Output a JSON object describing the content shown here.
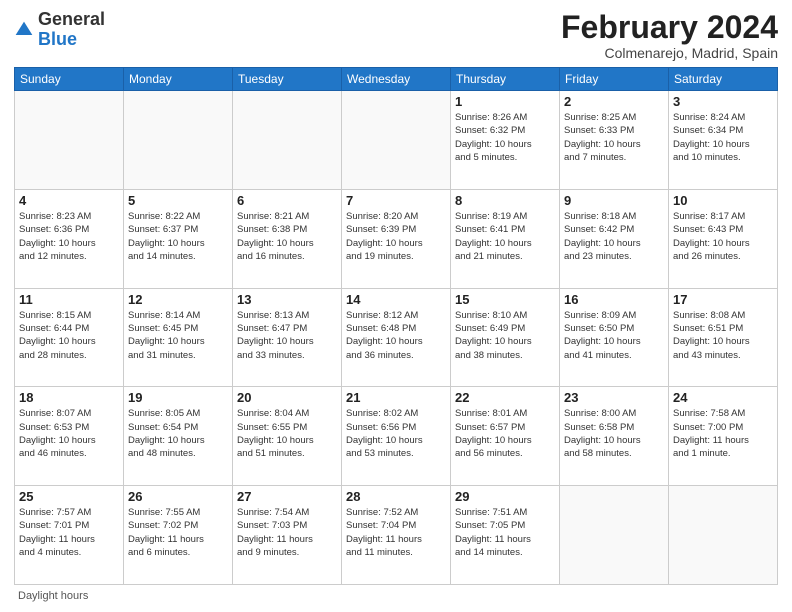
{
  "logo": {
    "general": "General",
    "blue": "Blue"
  },
  "header": {
    "month": "February 2024",
    "location": "Colmenarejo, Madrid, Spain"
  },
  "days_of_week": [
    "Sunday",
    "Monday",
    "Tuesday",
    "Wednesday",
    "Thursday",
    "Friday",
    "Saturday"
  ],
  "footer": {
    "label": "Daylight hours"
  },
  "weeks": [
    [
      {
        "day": "",
        "content": ""
      },
      {
        "day": "",
        "content": ""
      },
      {
        "day": "",
        "content": ""
      },
      {
        "day": "",
        "content": ""
      },
      {
        "day": "1",
        "content": "Sunrise: 8:26 AM\nSunset: 6:32 PM\nDaylight: 10 hours\nand 5 minutes."
      },
      {
        "day": "2",
        "content": "Sunrise: 8:25 AM\nSunset: 6:33 PM\nDaylight: 10 hours\nand 7 minutes."
      },
      {
        "day": "3",
        "content": "Sunrise: 8:24 AM\nSunset: 6:34 PM\nDaylight: 10 hours\nand 10 minutes."
      }
    ],
    [
      {
        "day": "4",
        "content": "Sunrise: 8:23 AM\nSunset: 6:36 PM\nDaylight: 10 hours\nand 12 minutes."
      },
      {
        "day": "5",
        "content": "Sunrise: 8:22 AM\nSunset: 6:37 PM\nDaylight: 10 hours\nand 14 minutes."
      },
      {
        "day": "6",
        "content": "Sunrise: 8:21 AM\nSunset: 6:38 PM\nDaylight: 10 hours\nand 16 minutes."
      },
      {
        "day": "7",
        "content": "Sunrise: 8:20 AM\nSunset: 6:39 PM\nDaylight: 10 hours\nand 19 minutes."
      },
      {
        "day": "8",
        "content": "Sunrise: 8:19 AM\nSunset: 6:41 PM\nDaylight: 10 hours\nand 21 minutes."
      },
      {
        "day": "9",
        "content": "Sunrise: 8:18 AM\nSunset: 6:42 PM\nDaylight: 10 hours\nand 23 minutes."
      },
      {
        "day": "10",
        "content": "Sunrise: 8:17 AM\nSunset: 6:43 PM\nDaylight: 10 hours\nand 26 minutes."
      }
    ],
    [
      {
        "day": "11",
        "content": "Sunrise: 8:15 AM\nSunset: 6:44 PM\nDaylight: 10 hours\nand 28 minutes."
      },
      {
        "day": "12",
        "content": "Sunrise: 8:14 AM\nSunset: 6:45 PM\nDaylight: 10 hours\nand 31 minutes."
      },
      {
        "day": "13",
        "content": "Sunrise: 8:13 AM\nSunset: 6:47 PM\nDaylight: 10 hours\nand 33 minutes."
      },
      {
        "day": "14",
        "content": "Sunrise: 8:12 AM\nSunset: 6:48 PM\nDaylight: 10 hours\nand 36 minutes."
      },
      {
        "day": "15",
        "content": "Sunrise: 8:10 AM\nSunset: 6:49 PM\nDaylight: 10 hours\nand 38 minutes."
      },
      {
        "day": "16",
        "content": "Sunrise: 8:09 AM\nSunset: 6:50 PM\nDaylight: 10 hours\nand 41 minutes."
      },
      {
        "day": "17",
        "content": "Sunrise: 8:08 AM\nSunset: 6:51 PM\nDaylight: 10 hours\nand 43 minutes."
      }
    ],
    [
      {
        "day": "18",
        "content": "Sunrise: 8:07 AM\nSunset: 6:53 PM\nDaylight: 10 hours\nand 46 minutes."
      },
      {
        "day": "19",
        "content": "Sunrise: 8:05 AM\nSunset: 6:54 PM\nDaylight: 10 hours\nand 48 minutes."
      },
      {
        "day": "20",
        "content": "Sunrise: 8:04 AM\nSunset: 6:55 PM\nDaylight: 10 hours\nand 51 minutes."
      },
      {
        "day": "21",
        "content": "Sunrise: 8:02 AM\nSunset: 6:56 PM\nDaylight: 10 hours\nand 53 minutes."
      },
      {
        "day": "22",
        "content": "Sunrise: 8:01 AM\nSunset: 6:57 PM\nDaylight: 10 hours\nand 56 minutes."
      },
      {
        "day": "23",
        "content": "Sunrise: 8:00 AM\nSunset: 6:58 PM\nDaylight: 10 hours\nand 58 minutes."
      },
      {
        "day": "24",
        "content": "Sunrise: 7:58 AM\nSunset: 7:00 PM\nDaylight: 11 hours\nand 1 minute."
      }
    ],
    [
      {
        "day": "25",
        "content": "Sunrise: 7:57 AM\nSunset: 7:01 PM\nDaylight: 11 hours\nand 4 minutes."
      },
      {
        "day": "26",
        "content": "Sunrise: 7:55 AM\nSunset: 7:02 PM\nDaylight: 11 hours\nand 6 minutes."
      },
      {
        "day": "27",
        "content": "Sunrise: 7:54 AM\nSunset: 7:03 PM\nDaylight: 11 hours\nand 9 minutes."
      },
      {
        "day": "28",
        "content": "Sunrise: 7:52 AM\nSunset: 7:04 PM\nDaylight: 11 hours\nand 11 minutes."
      },
      {
        "day": "29",
        "content": "Sunrise: 7:51 AM\nSunset: 7:05 PM\nDaylight: 11 hours\nand 14 minutes."
      },
      {
        "day": "",
        "content": ""
      },
      {
        "day": "",
        "content": ""
      }
    ]
  ]
}
